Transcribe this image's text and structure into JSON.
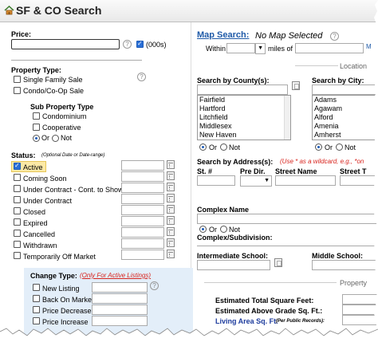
{
  "window": {
    "title": "SF & CO Search"
  },
  "left": {
    "price": {
      "label": "Price:",
      "value": "",
      "thousands_label": "(000s)"
    },
    "property_type": {
      "label": "Property Type:",
      "options": [
        "Single Family Sale",
        "Condo/Co-Op Sale"
      ]
    },
    "sub_property": {
      "label": "Sub Property Type",
      "options": [
        "Condominium",
        "Cooperative"
      ],
      "or": "Or",
      "not": "Not"
    },
    "status": {
      "label": "Status:",
      "note": "(Optional Date or Date-range)",
      "items": [
        "Active",
        "Coming Soon",
        "Under Contract - Cont. to Show",
        "Under Contract",
        "Closed",
        "Expired",
        "Cancelled",
        "Withdrawn",
        "Temporarily Off Market"
      ]
    },
    "change_type": {
      "label": "Change Type:",
      "note": "(Only For Active Listings)",
      "items": [
        "New Listing",
        "Back On Market",
        "Price Decrease",
        "Price Increase"
      ]
    }
  },
  "right": {
    "map": {
      "link": "Map Search:",
      "status": "No Map Selected",
      "within": "Within",
      "miles_of": "miles of"
    },
    "location_header": "Location",
    "county": {
      "label": "Search by County(s):",
      "items": [
        "Fairfield",
        "Hartford",
        "Litchfield",
        "Middlesex",
        "New Haven"
      ]
    },
    "city": {
      "label": "Search by City:",
      "items": [
        "Adams",
        "Agawam",
        "Alford",
        "Amenia",
        "Amherst"
      ]
    },
    "or": "Or",
    "not": "Not",
    "address": {
      "label": "Search by Address(s):",
      "note": "(Use * as a wildcard, e.g., *on",
      "cols": [
        "St. #",
        "Pre Dir.",
        "Street Name",
        "Street T"
      ]
    },
    "complex": {
      "label": "Complex Name",
      "sub_label": "Complex/Subdivision:"
    },
    "schools": {
      "intermediate": "Intermediate School:",
      "middle": "Middle School:"
    },
    "property_header": "Property",
    "sqft": {
      "total": "Estimated Total Square Feet:",
      "above": "Estimated Above Grade Sq. Ft.:",
      "living": "Living Area Sq. Ft.",
      "living_note": "(Per Public Records):"
    }
  }
}
